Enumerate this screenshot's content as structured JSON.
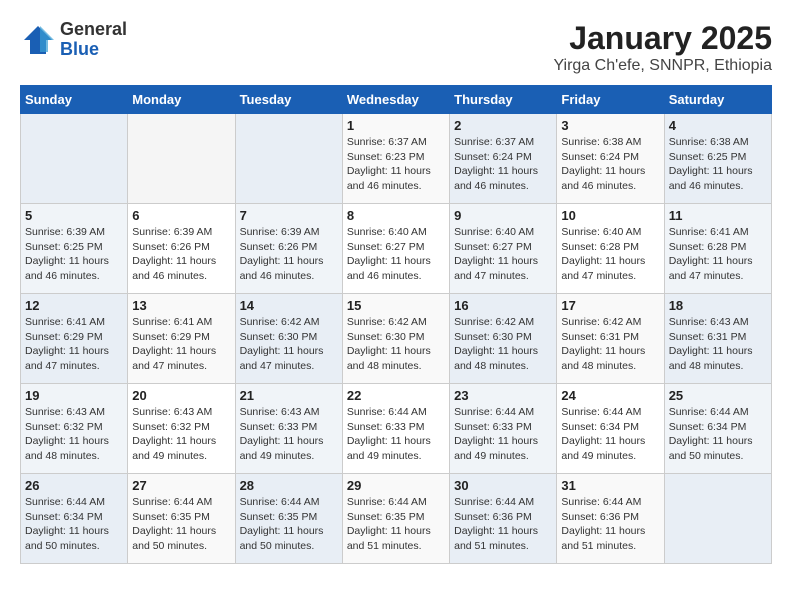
{
  "logo": {
    "general": "General",
    "blue": "Blue"
  },
  "title": "January 2025",
  "subtitle": "Yirga Ch'efe, SNNPR, Ethiopia",
  "days_of_week": [
    "Sunday",
    "Monday",
    "Tuesday",
    "Wednesday",
    "Thursday",
    "Friday",
    "Saturday"
  ],
  "weeks": [
    [
      {
        "day": "",
        "info": ""
      },
      {
        "day": "",
        "info": ""
      },
      {
        "day": "",
        "info": ""
      },
      {
        "day": "1",
        "info": "Sunrise: 6:37 AM\nSunset: 6:23 PM\nDaylight: 11 hours and 46 minutes."
      },
      {
        "day": "2",
        "info": "Sunrise: 6:37 AM\nSunset: 6:24 PM\nDaylight: 11 hours and 46 minutes."
      },
      {
        "day": "3",
        "info": "Sunrise: 6:38 AM\nSunset: 6:24 PM\nDaylight: 11 hours and 46 minutes."
      },
      {
        "day": "4",
        "info": "Sunrise: 6:38 AM\nSunset: 6:25 PM\nDaylight: 11 hours and 46 minutes."
      }
    ],
    [
      {
        "day": "5",
        "info": "Sunrise: 6:39 AM\nSunset: 6:25 PM\nDaylight: 11 hours and 46 minutes."
      },
      {
        "day": "6",
        "info": "Sunrise: 6:39 AM\nSunset: 6:26 PM\nDaylight: 11 hours and 46 minutes."
      },
      {
        "day": "7",
        "info": "Sunrise: 6:39 AM\nSunset: 6:26 PM\nDaylight: 11 hours and 46 minutes."
      },
      {
        "day": "8",
        "info": "Sunrise: 6:40 AM\nSunset: 6:27 PM\nDaylight: 11 hours and 46 minutes."
      },
      {
        "day": "9",
        "info": "Sunrise: 6:40 AM\nSunset: 6:27 PM\nDaylight: 11 hours and 47 minutes."
      },
      {
        "day": "10",
        "info": "Sunrise: 6:40 AM\nSunset: 6:28 PM\nDaylight: 11 hours and 47 minutes."
      },
      {
        "day": "11",
        "info": "Sunrise: 6:41 AM\nSunset: 6:28 PM\nDaylight: 11 hours and 47 minutes."
      }
    ],
    [
      {
        "day": "12",
        "info": "Sunrise: 6:41 AM\nSunset: 6:29 PM\nDaylight: 11 hours and 47 minutes."
      },
      {
        "day": "13",
        "info": "Sunrise: 6:41 AM\nSunset: 6:29 PM\nDaylight: 11 hours and 47 minutes."
      },
      {
        "day": "14",
        "info": "Sunrise: 6:42 AM\nSunset: 6:30 PM\nDaylight: 11 hours and 47 minutes."
      },
      {
        "day": "15",
        "info": "Sunrise: 6:42 AM\nSunset: 6:30 PM\nDaylight: 11 hours and 48 minutes."
      },
      {
        "day": "16",
        "info": "Sunrise: 6:42 AM\nSunset: 6:30 PM\nDaylight: 11 hours and 48 minutes."
      },
      {
        "day": "17",
        "info": "Sunrise: 6:42 AM\nSunset: 6:31 PM\nDaylight: 11 hours and 48 minutes."
      },
      {
        "day": "18",
        "info": "Sunrise: 6:43 AM\nSunset: 6:31 PM\nDaylight: 11 hours and 48 minutes."
      }
    ],
    [
      {
        "day": "19",
        "info": "Sunrise: 6:43 AM\nSunset: 6:32 PM\nDaylight: 11 hours and 48 minutes."
      },
      {
        "day": "20",
        "info": "Sunrise: 6:43 AM\nSunset: 6:32 PM\nDaylight: 11 hours and 49 minutes."
      },
      {
        "day": "21",
        "info": "Sunrise: 6:43 AM\nSunset: 6:33 PM\nDaylight: 11 hours and 49 minutes."
      },
      {
        "day": "22",
        "info": "Sunrise: 6:44 AM\nSunset: 6:33 PM\nDaylight: 11 hours and 49 minutes."
      },
      {
        "day": "23",
        "info": "Sunrise: 6:44 AM\nSunset: 6:33 PM\nDaylight: 11 hours and 49 minutes."
      },
      {
        "day": "24",
        "info": "Sunrise: 6:44 AM\nSunset: 6:34 PM\nDaylight: 11 hours and 49 minutes."
      },
      {
        "day": "25",
        "info": "Sunrise: 6:44 AM\nSunset: 6:34 PM\nDaylight: 11 hours and 50 minutes."
      }
    ],
    [
      {
        "day": "26",
        "info": "Sunrise: 6:44 AM\nSunset: 6:34 PM\nDaylight: 11 hours and 50 minutes."
      },
      {
        "day": "27",
        "info": "Sunrise: 6:44 AM\nSunset: 6:35 PM\nDaylight: 11 hours and 50 minutes."
      },
      {
        "day": "28",
        "info": "Sunrise: 6:44 AM\nSunset: 6:35 PM\nDaylight: 11 hours and 50 minutes."
      },
      {
        "day": "29",
        "info": "Sunrise: 6:44 AM\nSunset: 6:35 PM\nDaylight: 11 hours and 51 minutes."
      },
      {
        "day": "30",
        "info": "Sunrise: 6:44 AM\nSunset: 6:36 PM\nDaylight: 11 hours and 51 minutes."
      },
      {
        "day": "31",
        "info": "Sunrise: 6:44 AM\nSunset: 6:36 PM\nDaylight: 11 hours and 51 minutes."
      },
      {
        "day": "",
        "info": ""
      }
    ]
  ]
}
